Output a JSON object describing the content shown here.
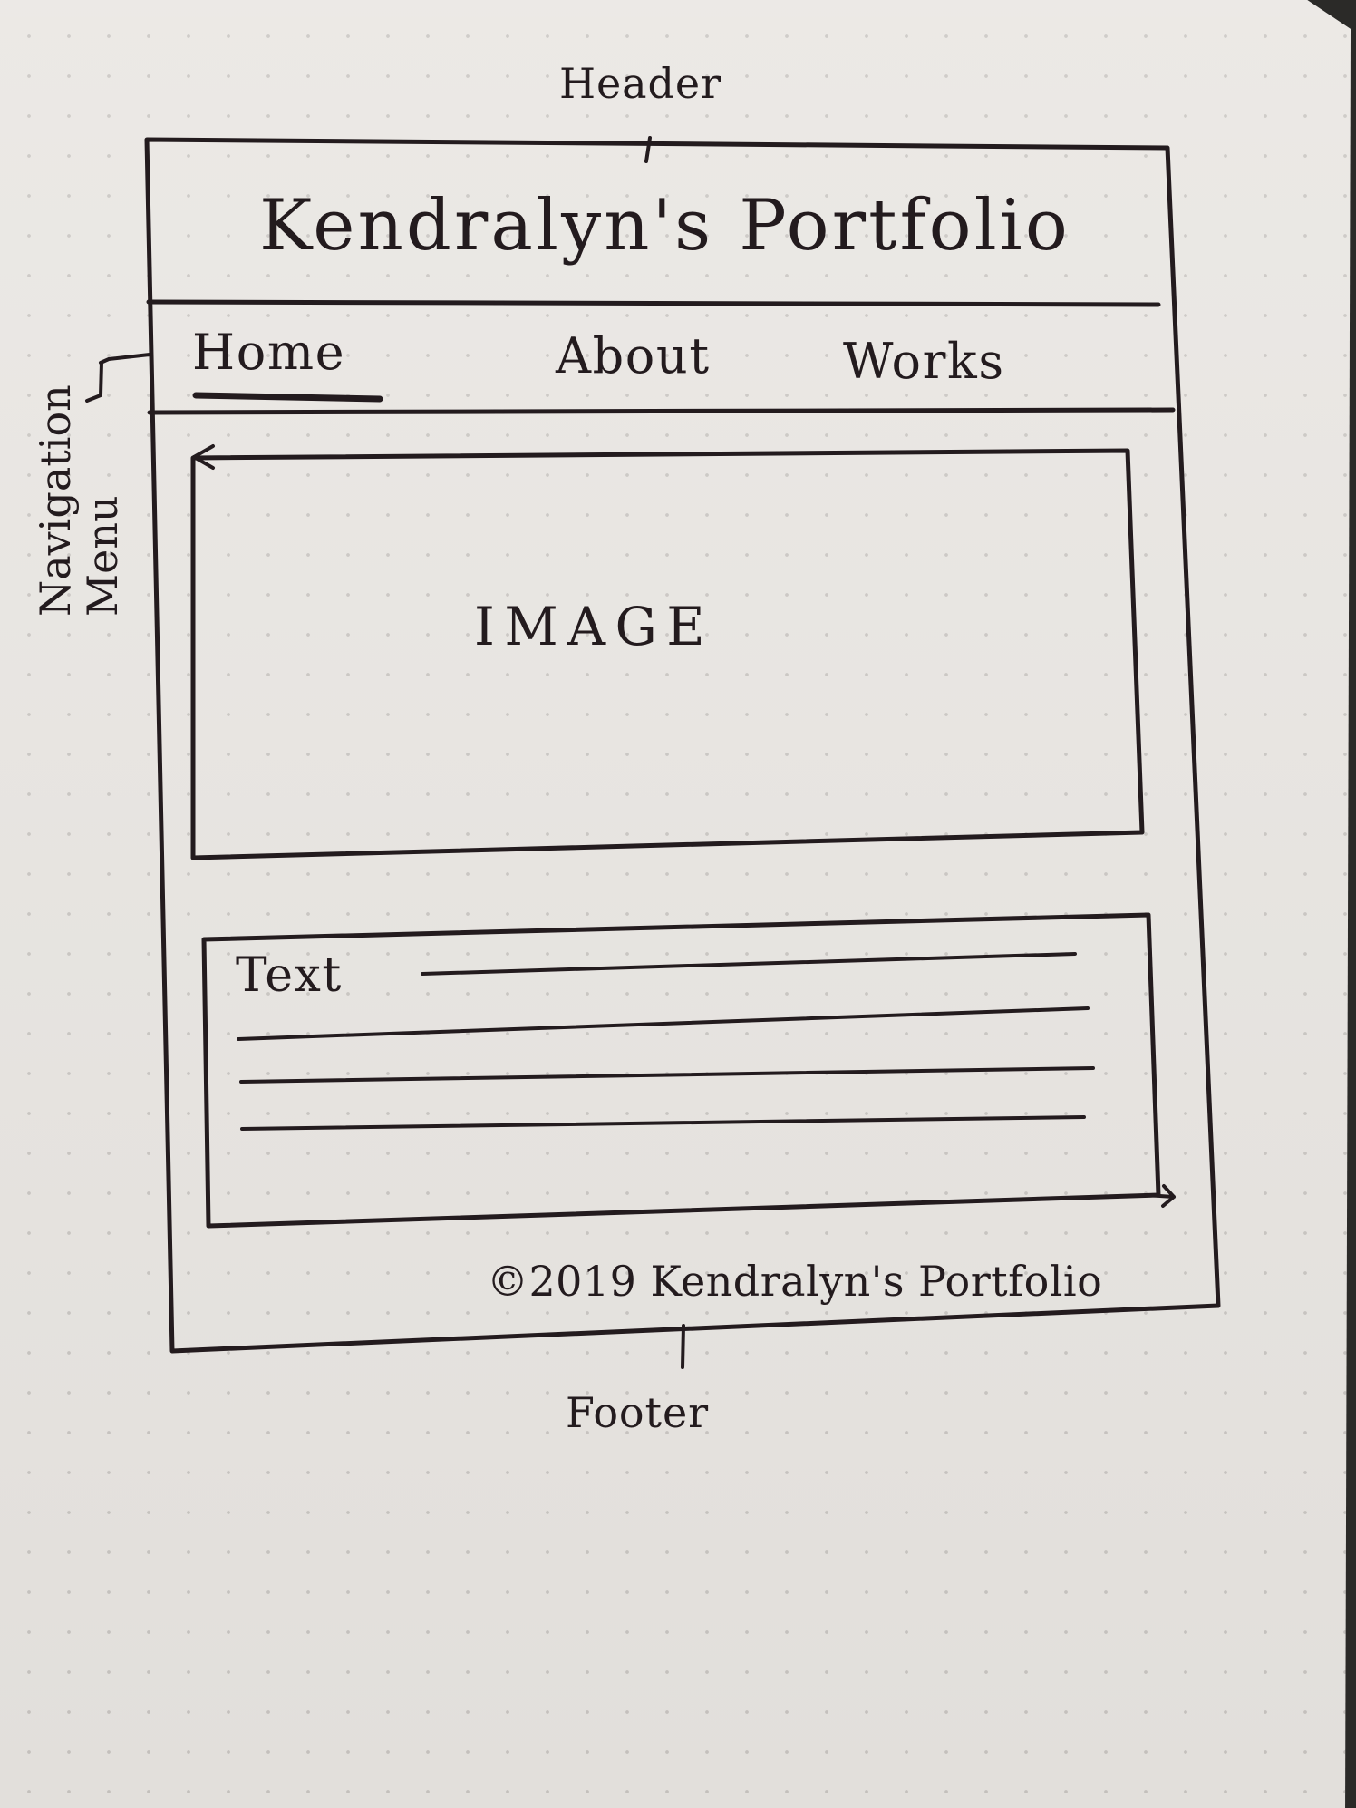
{
  "labels": {
    "header": "Header",
    "navigation_menu": [
      "Navigation",
      "Menu"
    ],
    "footer": "Footer"
  },
  "mockup": {
    "site_title": "Kendralyn's Portfolio",
    "navigation": [
      {
        "label": "Home",
        "active": true
      },
      {
        "label": "About",
        "active": false
      },
      {
        "label": "Works",
        "active": false
      }
    ],
    "image_placeholder": "IMAGE",
    "text_placeholder": "Text",
    "footer_text": "©2019 Kendralyn's Portfolio"
  }
}
